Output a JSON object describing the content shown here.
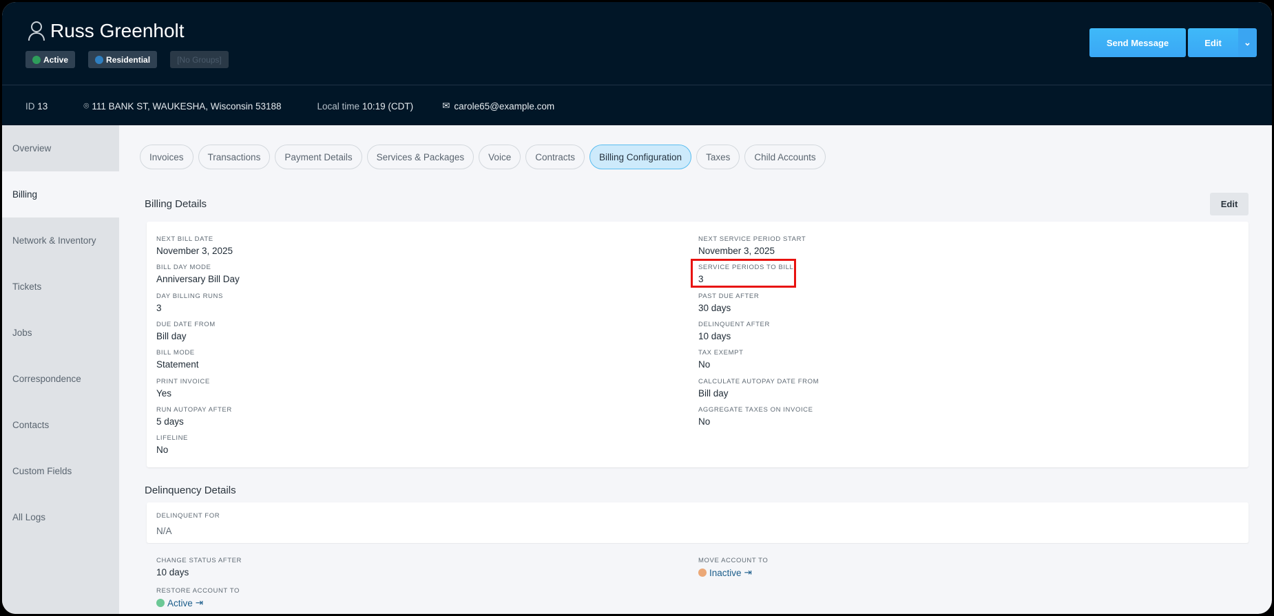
{
  "header": {
    "name": "Russ Greenholt",
    "badges": [
      {
        "label": "Active",
        "color": "#2e9e5b"
      },
      {
        "label": "Residential",
        "color": "#2f7fc0"
      },
      {
        "label": "[No Groups]"
      }
    ],
    "send_message": "Send Message",
    "edit": "Edit",
    "id_label": "ID",
    "id_value": "13",
    "address": "111 BANK ST, WAUKESHA, Wisconsin 53188",
    "local_time_label": "Local time",
    "local_time": "10:19 (CDT)",
    "email": "carole65@example.com"
  },
  "sidebar": [
    "Overview",
    "Billing",
    "Network & Inventory",
    "Tickets",
    "Jobs",
    "Correspondence",
    "Contacts",
    "Custom Fields",
    "All Logs"
  ],
  "tabs": [
    "Invoices",
    "Transactions",
    "Payment Details",
    "Services & Packages",
    "Voice",
    "Contracts",
    "Billing Configuration",
    "Taxes",
    "Child Accounts"
  ],
  "billing": {
    "title": "Billing Details",
    "edit": "Edit",
    "left": [
      {
        "label": "Next Bill Date",
        "value": "November 3, 2025"
      },
      {
        "label": "Bill Day Mode",
        "value": "Anniversary Bill Day"
      },
      {
        "label": "Day Billing Runs",
        "value": "3"
      },
      {
        "label": "Due Date From",
        "value": "Bill day"
      },
      {
        "label": "Bill Mode",
        "value": "Statement"
      },
      {
        "label": "Print Invoice",
        "value": "Yes"
      },
      {
        "label": "Run Autopay After",
        "value": "5 days"
      },
      {
        "label": "Lifeline",
        "value": "No"
      }
    ],
    "right": [
      {
        "label": "Next Service Period Start",
        "value": "November 3, 2025"
      },
      {
        "label": "Service Periods To Bill",
        "value": "3"
      },
      {
        "label": "Past Due After",
        "value": "30 days"
      },
      {
        "label": "Delinquent After",
        "value": "10 days"
      },
      {
        "label": "Tax Exempt",
        "value": "No"
      },
      {
        "label": "Calculate Autopay Date From",
        "value": "Bill day"
      },
      {
        "label": "Aggregate Taxes On Invoice",
        "value": "No"
      }
    ]
  },
  "delinquency": {
    "title": "Delinquency Details",
    "delinquent_for_label": "Delinquent For",
    "delinquent_for": "N/A",
    "change_status_label": "Change Status After",
    "change_status": "10 days",
    "move_label": "Move Account To",
    "move_value": "Inactive",
    "move_color": "#eba877",
    "restore_label": "Restore Account To",
    "restore_value": "Active",
    "restore_color": "#6cc896"
  }
}
